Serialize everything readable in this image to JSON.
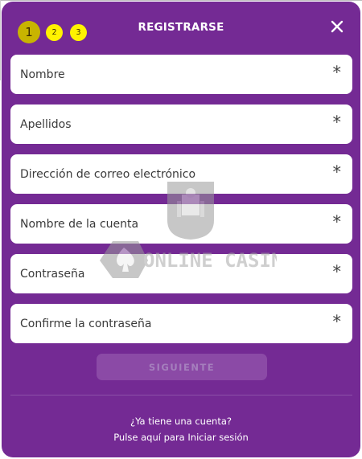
{
  "header": {
    "title": "REGISTRARSE",
    "steps": [
      {
        "label": "1",
        "active": true
      },
      {
        "label": "2",
        "active": false
      },
      {
        "label": "3",
        "active": false
      }
    ],
    "close_icon": "close-icon"
  },
  "form": {
    "fields": [
      {
        "placeholder": "Nombre",
        "required_marker": "*"
      },
      {
        "placeholder": "Apellidos",
        "required_marker": "*"
      },
      {
        "placeholder": "Dirección de correo electrónico",
        "required_marker": "*"
      },
      {
        "placeholder": "Nombre de la cuenta",
        "required_marker": "*"
      },
      {
        "placeholder": "Contraseña",
        "required_marker": "*"
      },
      {
        "placeholder": "Confirme la contraseña",
        "required_marker": "*"
      }
    ],
    "next_label": "SIGUIENTE"
  },
  "footer": {
    "question": "¿Ya tiene una cuenta?",
    "login_link": "Pulse aquí para Iniciar sesión"
  },
  "watermark": {
    "text": "ONLINE CASINO"
  },
  "colors": {
    "background": "#742a94",
    "step_active": "#c8b400",
    "step_inactive": "#fff200",
    "button_disabled": "#8b4aa6"
  }
}
